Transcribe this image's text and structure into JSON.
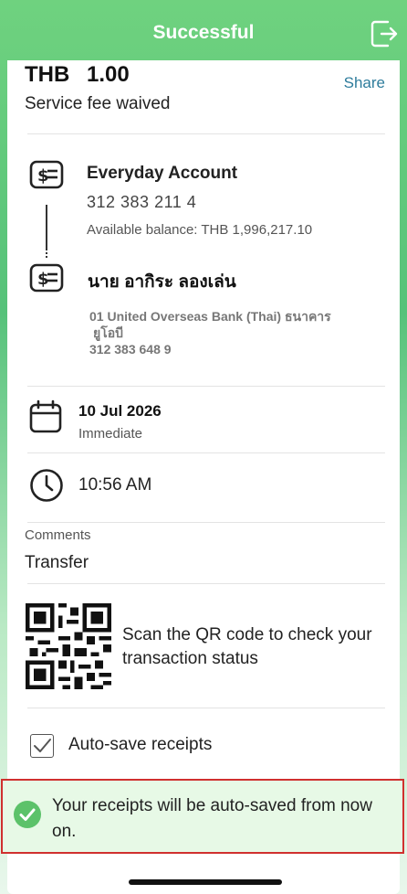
{
  "header": {
    "title": "Successful",
    "exit_icon": "exit-icon"
  },
  "amount": {
    "currency": "THB",
    "value": "1.00",
    "share_label": "Share",
    "fee_note": "Service fee waived"
  },
  "from_account": {
    "icon": "money-doc-icon",
    "name": "Everyday Account",
    "number": "312 383 211 4",
    "balance": "Available balance: THB 1,996,217.10"
  },
  "to_account": {
    "icon": "money-doc-icon",
    "name": "นาย อากิระ ลองเล่น",
    "bank_line1": "01 United Overseas Bank (Thai) ธนาคาร",
    "bank_line2": "ยูโอบี",
    "number": "312 383 648 9"
  },
  "schedule": {
    "icon": "calendar-icon",
    "date": "10 Jul 2026",
    "type": "Immediate"
  },
  "time": {
    "icon": "clock-icon",
    "value": "10:56 AM"
  },
  "comments": {
    "label": "Comments",
    "value": "Transfer"
  },
  "qr": {
    "icon": "qr-code",
    "text": "Scan the QR code to check your transaction status"
  },
  "autosave": {
    "label": "Auto-save receipts",
    "checked": true
  },
  "toast": {
    "icon": "check-circle-icon",
    "message": "Your receipts will be auto-saved from now on.",
    "color": "#5cc26a"
  },
  "colors": {
    "accent": "#5cc26a",
    "link": "#2e7c9c",
    "highlight_border": "#d0302f"
  }
}
